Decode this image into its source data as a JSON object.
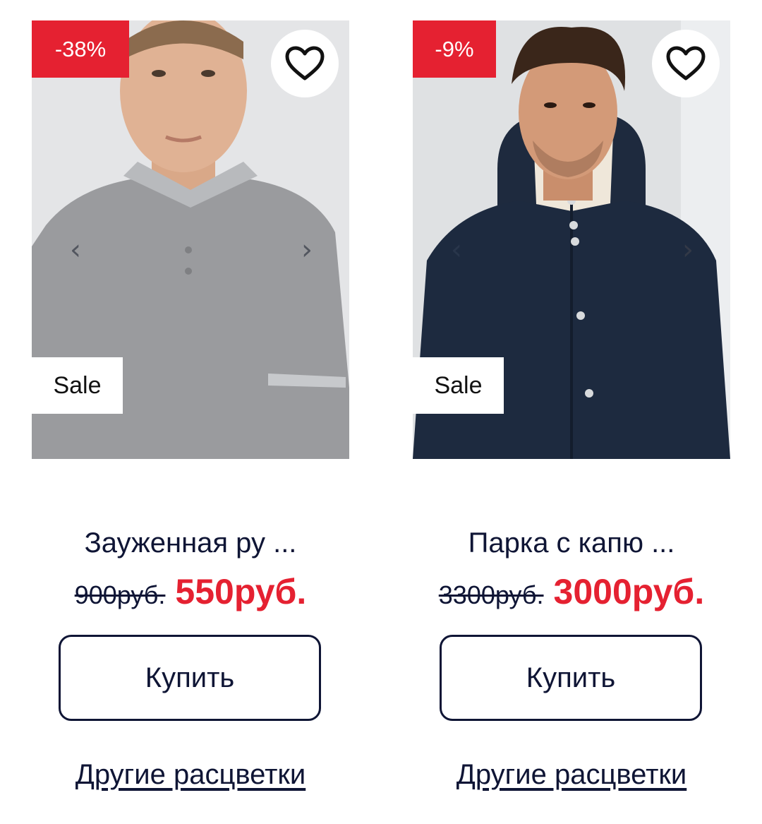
{
  "products": [
    {
      "discount": "-38%",
      "badge": "Sale",
      "title": "Зауженная ру ...",
      "old_price": "900руб.",
      "new_price": "550руб.",
      "buy_label": "Купить",
      "colors_link": "Другие расцветки",
      "image": "man-grey-polo-shirt"
    },
    {
      "discount": "-9%",
      "badge": "Sale",
      "title": "Парка с капю ...",
      "old_price": "3300руб.",
      "new_price": "3000руб.",
      "buy_label": "Купить",
      "colors_link": "Другие расцветки",
      "image": "man-navy-hooded-parka"
    }
  ],
  "icons": {
    "favorite": "heart-outline-icon",
    "prev": "chevron-left-icon",
    "next": "chevron-right-icon"
  },
  "colors": {
    "accent_red": "#e52131",
    "text_navy": "#0f1535"
  }
}
